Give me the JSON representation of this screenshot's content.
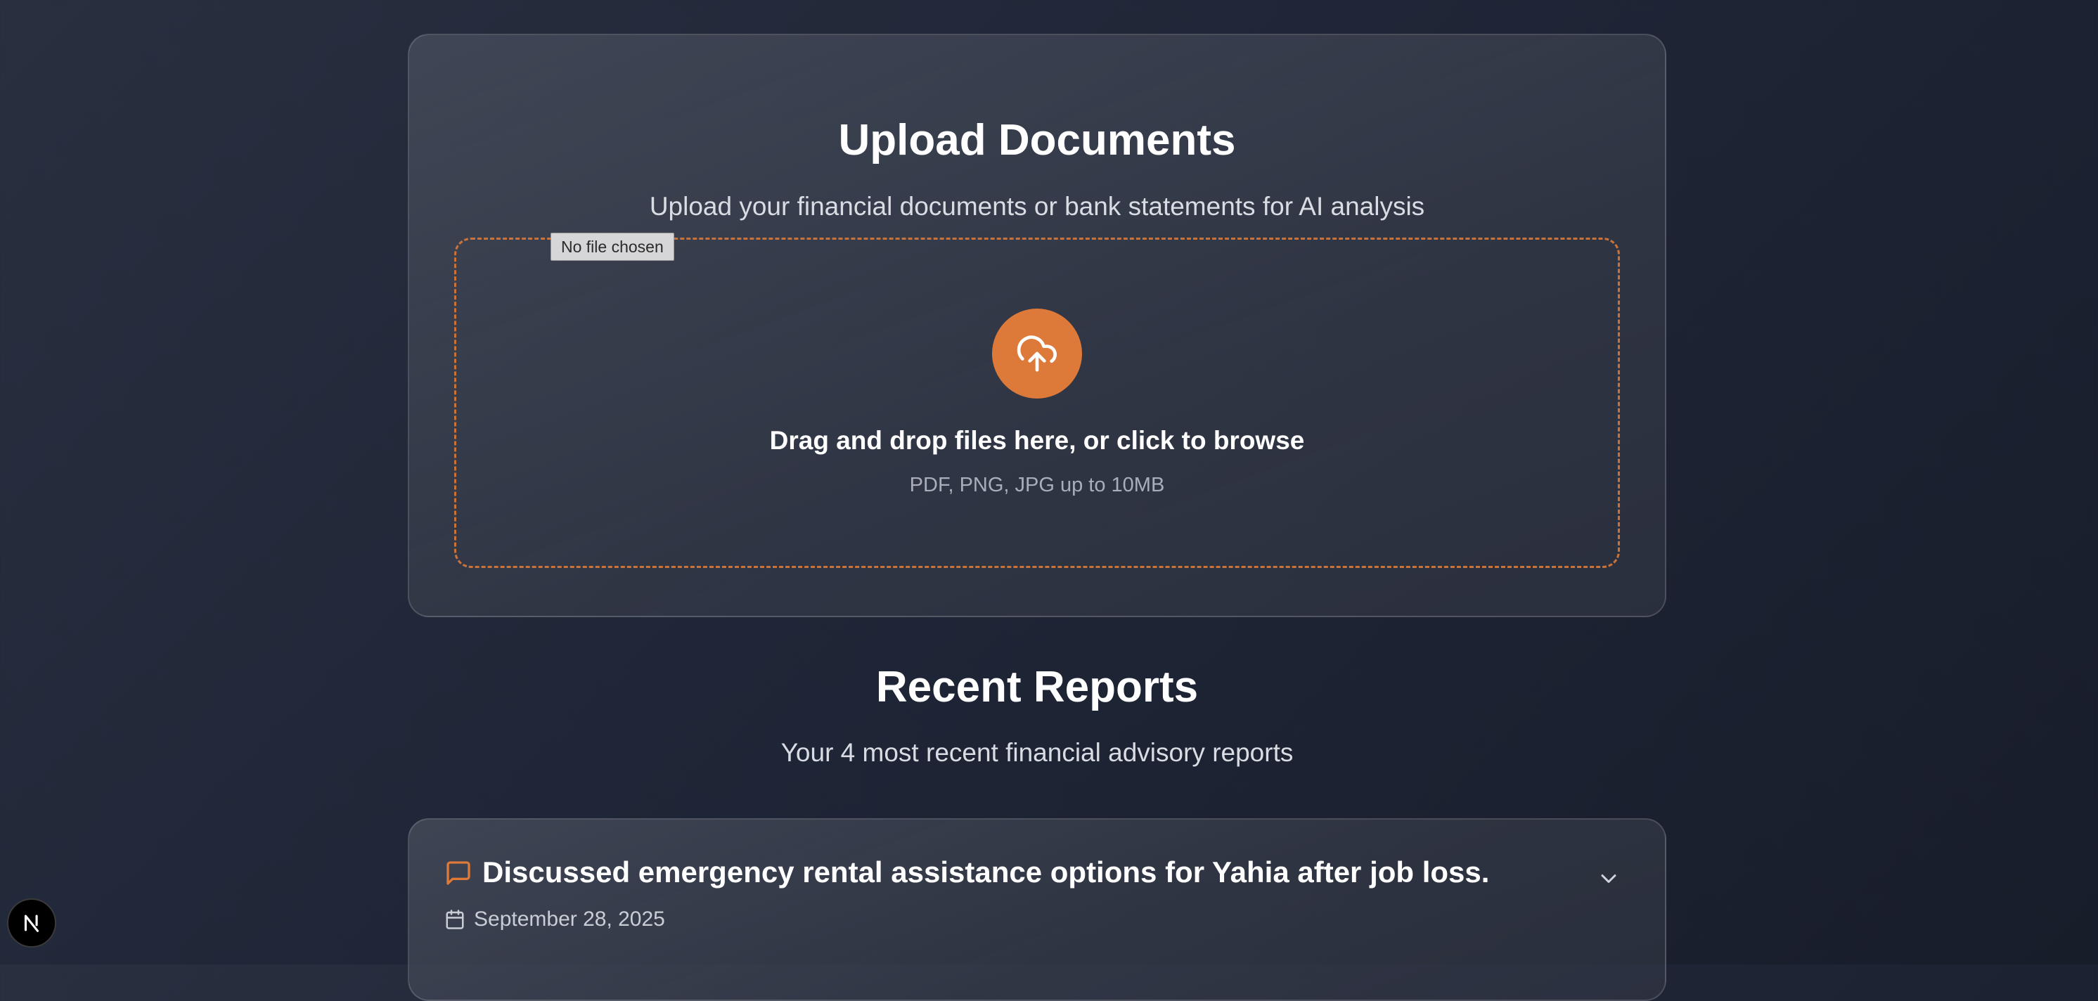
{
  "upload": {
    "title": "Upload Documents",
    "subtitle": "Upload your financial documents or bank statements for AI analysis",
    "file_input_status": "No file chosen",
    "drop_text": "Drag and drop files here, or click to browse",
    "drop_hint": "PDF, PNG, JPG up to 10MB",
    "icon": "cloud-upload-icon"
  },
  "reports": {
    "title": "Recent Reports",
    "subtitle": "Your 4 most recent financial advisory reports",
    "items": [
      {
        "title": "Discussed emergency rental assistance options for Yahia after job loss.",
        "date": "September 28, 2025",
        "icon": "message-square-icon"
      }
    ]
  },
  "dev_badge": {
    "icon": "nextjs-logo-icon"
  },
  "colors": {
    "accent": "#dd7a3a",
    "dashed_border": "#c9733a",
    "background": "#1f2637",
    "card": "#3a3f4c"
  }
}
